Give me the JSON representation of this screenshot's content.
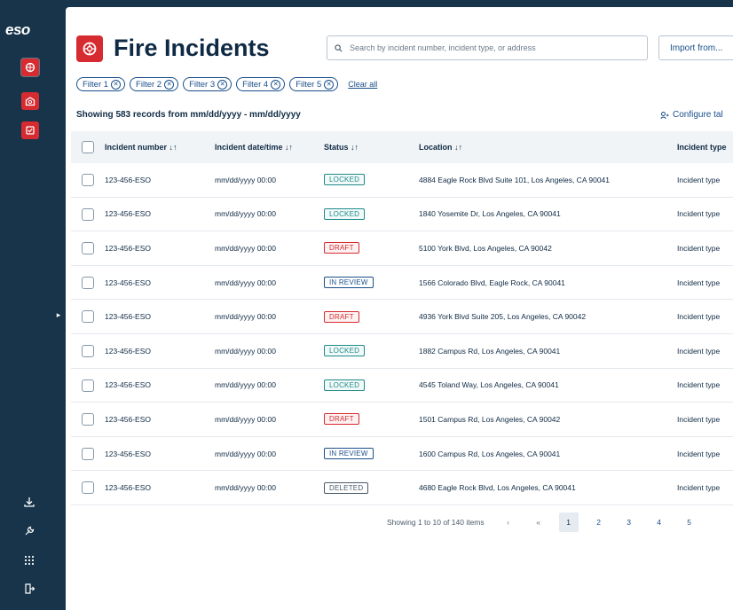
{
  "app": {
    "logo": "eso"
  },
  "header": {
    "title": "Fire Incidents",
    "search_placeholder": "Search by incident number, incident type, or address",
    "import_label": "Import from..."
  },
  "filters": {
    "chips": [
      "Filter 1",
      "Filter 2",
      "Filter 3",
      "Filter 4",
      "Filter 5"
    ],
    "clear_label": "Clear all"
  },
  "summary": {
    "records_text": "Showing 583 records from mm/dd/yyyy - mm/dd/yyyy",
    "configure_label": "Configure tal"
  },
  "table": {
    "columns": [
      "Incident number ↓↑",
      "Incident date/time ↓↑",
      "Status ↓↑",
      "Location ↓↑",
      "Incident type"
    ],
    "rows": [
      {
        "number": "123-456-ESO",
        "date": "mm/dd/yyyy 00:00",
        "status": "LOCKED",
        "location": "4884 Eagle Rock Blvd Suite 101, Los Angeles, CA 90041",
        "type": "Incident type"
      },
      {
        "number": "123-456-ESO",
        "date": "mm/dd/yyyy 00:00",
        "status": "LOCKED",
        "location": "1840 Yosemite Dr, Los Angeles, CA 90041",
        "type": "Incident type"
      },
      {
        "number": "123-456-ESO",
        "date": "mm/dd/yyyy 00:00",
        "status": "DRAFT",
        "location": "5100 York Blvd, Los Angeles, CA 90042",
        "type": "Incident type"
      },
      {
        "number": "123-456-ESO",
        "date": "mm/dd/yyyy 00:00",
        "status": "IN REVIEW",
        "location": "1566 Colorado Blvd, Eagle Rock, CA 90041",
        "type": "Incident type"
      },
      {
        "number": "123-456-ESO",
        "date": "mm/dd/yyyy 00:00",
        "status": "DRAFT",
        "location": "4936 York Blvd Suite 205, Los Angeles, CA 90042",
        "type": "Incident type"
      },
      {
        "number": "123-456-ESO",
        "date": "mm/dd/yyyy 00:00",
        "status": "LOCKED",
        "location": "1882 Campus Rd, Los Angeles, CA 90041",
        "type": "Incident type"
      },
      {
        "number": "123-456-ESO",
        "date": "mm/dd/yyyy 00:00",
        "status": "LOCKED",
        "location": "4545 Toland Way, Los Angeles, CA 90041",
        "type": "Incident type"
      },
      {
        "number": "123-456-ESO",
        "date": "mm/dd/yyyy 00:00",
        "status": "DRAFT",
        "location": "1501 Campus Rd, Los Angeles, CA 90042",
        "type": "Incident type"
      },
      {
        "number": "123-456-ESO",
        "date": "mm/dd/yyyy 00:00",
        "status": "IN REVIEW",
        "location": "1600 Campus Rd, Los Angeles, CA 90041",
        "type": "Incident type"
      },
      {
        "number": "123-456-ESO",
        "date": "mm/dd/yyyy 00:00",
        "status": "DELETED",
        "location": "4680 Eagle Rock Blvd, Los Angeles, CA 90041",
        "type": "Incident type"
      }
    ]
  },
  "status_colors": {
    "LOCKED": "#1f8a8a",
    "DRAFT": "#d62b30",
    "IN REVIEW": "#1a4f8a",
    "DELETED": "#4a5a6a"
  },
  "pagination": {
    "summary": "Showing 1 to 10 of 140 items",
    "prev_icon": "‹",
    "first_icon": "«",
    "pages": [
      "1",
      "2",
      "3",
      "4",
      "5"
    ],
    "current": "1"
  },
  "colors": {
    "brand_red": "#d62b30",
    "nav_dark": "#17344a",
    "link_blue": "#1a4f8a"
  }
}
